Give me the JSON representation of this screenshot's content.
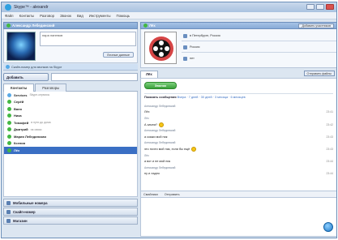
{
  "window": {
    "title": "Skype™ - alexandr"
  },
  "menu": [
    "Файл",
    "Контакты",
    "Разговор",
    "Звонок",
    "Вид",
    "Инструменты",
    "Помощь"
  ],
  "profile": {
    "name": "Александр Лебединский",
    "mood_placeholder": "пара напевов",
    "mood_button": "Личные данные"
  },
  "status_line": "Скайп-номер для звонков на Skype",
  "add_button": "Добавить",
  "left_tabs": [
    "Контакты",
    "Разговоры"
  ],
  "contacts": [
    {
      "name": "Services",
      "mood": "Skype-сервисы",
      "color": "#5aa9e6"
    },
    {
      "name": "Серёй",
      "mood": "",
      "color": "#43b843"
    },
    {
      "name": "Ваня",
      "mood": "",
      "color": "#43b843"
    },
    {
      "name": "Ника",
      "mood": "",
      "color": "#43b843"
    },
    {
      "name": "Тимофей",
      "mood": "в пути до дома",
      "color": "#43b843"
    },
    {
      "name": "Дмитрий",
      "mood": "на связи",
      "color": "#43b843"
    },
    {
      "name": "Мария Лебединская",
      "mood": "",
      "color": "#43b843"
    },
    {
      "name": "Ксения",
      "mood": "",
      "color": "#43b843"
    },
    {
      "name": "Лёх",
      "mood": "",
      "color": "#43b843",
      "selected": true
    }
  ],
  "sections": [
    "Мобильные номера",
    "Скайп-номер",
    "Магазин"
  ],
  "conversation": {
    "title": "Лёх",
    "add_people": "Добавить участников",
    "info": [
      "в Петербурге, Россия",
      "Россия",
      "нет"
    ],
    "tab": "Лёх",
    "send_file": "Отправить файлы",
    "call_button": "Звонок",
    "history_label": "Показать сообщения",
    "history_links": "Вчера · 7 дней · 30 дней · 3 месяца · 6 месяцев",
    "messages": [
      {
        "sender": "Александр Лебединский",
        "text": "",
        "time": ""
      },
      {
        "sender": "",
        "text": "Лёх",
        "time": "23:41"
      },
      {
        "sender": "Лёх",
        "text": "",
        "time": ""
      },
      {
        "sender": "",
        "text": "А зачем?",
        "time": "23:42",
        "smiley": true
      },
      {
        "sender": "Александр Лебединский",
        "text": "",
        "time": ""
      },
      {
        "sender": "",
        "text": "а скажи мой ник",
        "time": "23:43"
      },
      {
        "sender": "Александр Лебединский",
        "text": "",
        "time": ""
      },
      {
        "sender": "",
        "text": "это почти мой ник, если бы ещё",
        "time": "23:43",
        "smiley": true
      },
      {
        "sender": "Лёх",
        "text": "",
        "time": ""
      },
      {
        "sender": "",
        "text": "а вот и не мой ник",
        "time": "23:44"
      },
      {
        "sender": "Александр Лебединский",
        "text": "",
        "time": ""
      },
      {
        "sender": "",
        "text": "ну и ладно",
        "time": "23:44"
      }
    ],
    "input_tools": [
      "Смайлики",
      "Отправить"
    ]
  },
  "colors": {
    "accent": "#3a6fc4",
    "online": "#43b843",
    "header": "#88abd7"
  }
}
